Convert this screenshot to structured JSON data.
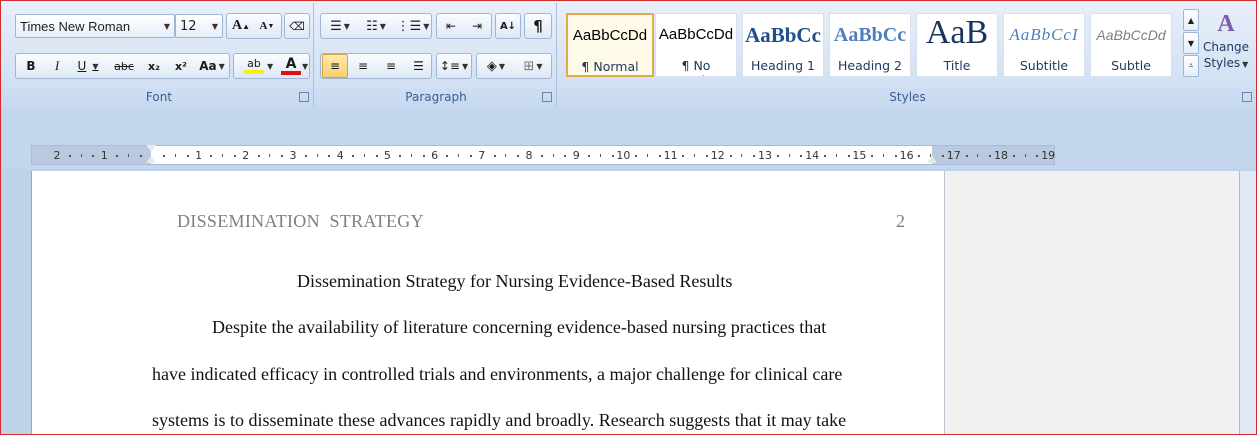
{
  "ribbon": {
    "font": {
      "label": "Font",
      "font_name": "Times New Roman",
      "font_size": "12",
      "grow_label": "A",
      "shrink_label": "A",
      "bold": "B",
      "italic": "I",
      "underline": "U",
      "strike": "abc",
      "subscript": "x₂",
      "superscript": "x²",
      "case": "Aa",
      "highlight": "ab",
      "font_color": "A",
      "highlight_color": "#f5f010",
      "font_color_value": "#e01010"
    },
    "paragraph": {
      "label": "Paragraph",
      "pilcrow": "¶"
    },
    "styles": {
      "label": "Styles",
      "items": [
        {
          "sample": "AaBbCcDd",
          "name": "¶ Normal"
        },
        {
          "sample": "AaBbCcDd",
          "name": "¶ No Spacing"
        },
        {
          "sample": "AaBbCc",
          "name": "Heading 1"
        },
        {
          "sample": "AaBbCc",
          "name": "Heading 2"
        },
        {
          "sample": "AaB",
          "name": "Title"
        },
        {
          "sample": "AaBbCcI",
          "name": "Subtitle"
        },
        {
          "sample": "AaBbCcDd",
          "name": "Subtle Emp..."
        }
      ],
      "change_styles_line1": "Change",
      "change_styles_line2": "Styles"
    }
  },
  "ruler": {
    "labels": [
      "2",
      "1",
      "",
      "1",
      "2",
      "3",
      "4",
      "5",
      "6",
      "7",
      "8",
      "9",
      "10",
      "11",
      "12",
      "13",
      "14",
      "15",
      "16",
      "17",
      "18",
      "19"
    ]
  },
  "document": {
    "header_title": "DISSEMINATION  STRATEGY",
    "page_number": "2",
    "title": "Dissemination Strategy for Nursing Evidence-Based Results",
    "lines": [
      "Despite the availability of literature concerning evidence-based nursing practices that",
      "have indicated efficacy in controlled trials and environments, a major challenge for clinical care",
      "systems is to disseminate these advances rapidly and broadly. Research suggests that it may take"
    ]
  }
}
